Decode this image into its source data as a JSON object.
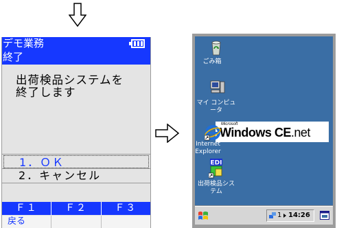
{
  "handheld": {
    "title": "デモ業務",
    "subtitle": "終了",
    "message_lines": [
      "出荷検品システムを",
      "終了します"
    ],
    "options": [
      "1．ＯＫ",
      "2．キャンセル"
    ],
    "function_keys": [
      "Ｆ１",
      "Ｆ２",
      "Ｆ３"
    ],
    "soft_keys": [
      "戻る",
      "",
      ""
    ]
  },
  "desktop": {
    "icons": {
      "recycle_bin": "ごみ箱",
      "my_computer": "マイ コンピュータ",
      "internet_explorer": "Internet Explorer",
      "edi_app": "出荷検品システム",
      "edi_badge": "EDI"
    },
    "logo": {
      "brand": "Microsoft",
      "name": "Windows",
      "suffix": "CE",
      "tld": ".net"
    },
    "taskbar": {
      "tray_number": "1",
      "time": "14:26"
    }
  }
}
